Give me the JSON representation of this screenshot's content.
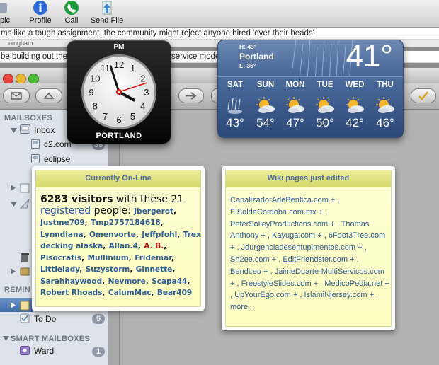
{
  "mail_toolbar": {
    "items": [
      {
        "label": "pic",
        "icon": "topic-icon"
      },
      {
        "label": "Profile",
        "icon": "info-icon"
      },
      {
        "label": "Call",
        "icon": "phone-icon"
      },
      {
        "label": "Send File",
        "icon": "send-file-icon"
      }
    ]
  },
  "background_lines": {
    "line1": "ms like a tough assignment. the community might reject anyone hired 'over their heads'",
    "line2": "ningham",
    "line3": "be building out the",
    "line3b": "service mode"
  },
  "sidebar": {
    "mailboxes_header": "MAILBOXES",
    "inbox_label": "Inbox",
    "inbox_children": [
      "c2.com",
      "eclipse"
    ],
    "inbox_badge": "38",
    "reminders_header": "REMIN",
    "todo_label": "To Do",
    "todo_badge": "5",
    "smart_header": "SMART MAILBOXES",
    "ward_label": "Ward",
    "ward_badge": "1"
  },
  "clock": {
    "ampm": "PM",
    "city": "PORTLAND",
    "numerals": [
      "12",
      "1",
      "2",
      "3",
      "4",
      "5",
      "6",
      "7",
      "8",
      "9",
      "10",
      "11"
    ],
    "hour": 3,
    "minute": 57,
    "second": 12
  },
  "weather": {
    "high": "H: 43°",
    "low": "L: 36°",
    "city": "Portland",
    "current_temp": "41°",
    "days": [
      {
        "day": "SAT",
        "temp": "43°",
        "icon": "rain-icon"
      },
      {
        "day": "SUN",
        "temp": "54°",
        "icon": "sun-cloud-icon"
      },
      {
        "day": "MON",
        "temp": "47°",
        "icon": "sun-cloud-icon"
      },
      {
        "day": "TUE",
        "temp": "50°",
        "icon": "sun-cloud-icon"
      },
      {
        "day": "WED",
        "temp": "42°",
        "icon": "sun-cloud-icon"
      },
      {
        "day": "THU",
        "temp": "46°",
        "icon": "sun-cloud-icon"
      }
    ]
  },
  "online_widget": {
    "title": "Currently On-Line",
    "visitors": "6283 visitors",
    "with_these": " with these 21",
    "registered": "registered",
    "people": " people:",
    "users": [
      "Jbergerot",
      "Justme709",
      "Tmp2757184618",
      "Lynndiana",
      "Omenvorte",
      "Jeffpfohl",
      "Trex decking alaska",
      "Allan.4",
      "A. B.",
      "Pisocratis",
      "Mullinium",
      "Fridemar",
      "Littlelady",
      "Suzystorm",
      "Ginnette",
      "Sarahhaywood",
      "Nevmore",
      "Scapa44",
      "Robert Rhoads",
      "CalumMac",
      "Bear409"
    ],
    "highlighted_user": "A. B."
  },
  "wiki_widget": {
    "title": "Wiki pages just edited",
    "pages": [
      "CanalizadorAdeBenfica.com",
      "ElSoldeCordoba.com.mx",
      "PeterSolleyProductions.com",
      "Thomas Anthony",
      "Kayuga.com",
      "6Foot3Tree.com",
      "Jdurgenciadesentupimentos.com",
      "Sh2ee.com",
      "EditFriendster.com",
      "Bendt.eu",
      "JaimeDuarte-MultiServicos.com",
      "FreestyleSlides.com",
      "MedicoPedia.net",
      "UpYourEgo.com",
      "IslamiNjersey.com"
    ],
    "more": "more..."
  },
  "colors": {
    "link": "#2e5e97",
    "highlight": "#c01919",
    "note_yellow": "#ffffd6",
    "weather_blue": "#3f5e91"
  }
}
